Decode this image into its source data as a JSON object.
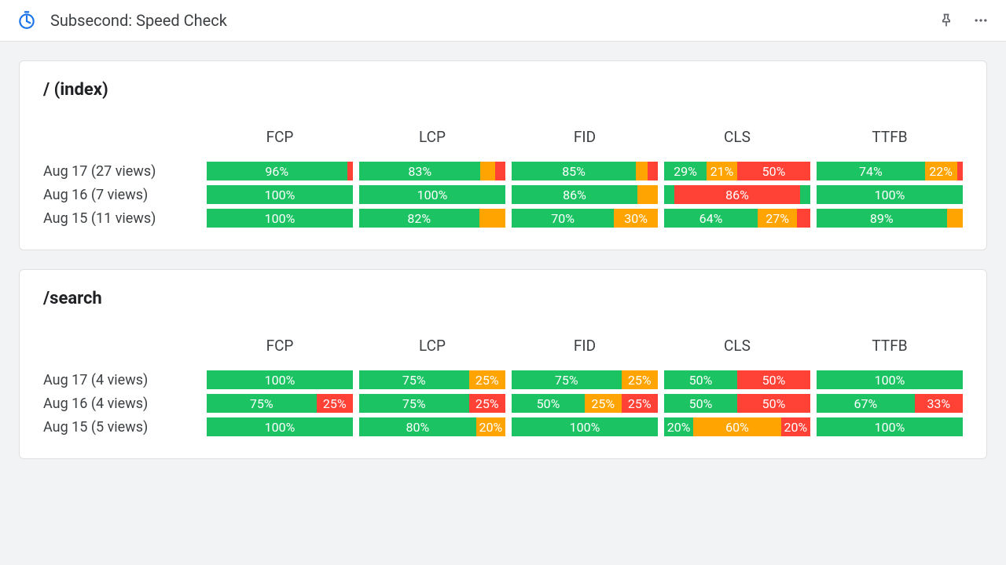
{
  "header": {
    "title": "Subsecond: Speed Check"
  },
  "columns": [
    "FCP",
    "LCP",
    "FID",
    "CLS",
    "TTFB"
  ],
  "colors": {
    "good": "#1cc363",
    "ok": "#ffa400",
    "bad": "#ff4136"
  },
  "cards": [
    {
      "title": "/ (index)",
      "rows": [
        {
          "label": "Aug 17 (27 views)",
          "metrics": [
            [
              {
                "c": "green",
                "p": 96,
                "t": "96%"
              },
              {
                "c": "red",
                "p": 4,
                "t": ""
              }
            ],
            [
              {
                "c": "green",
                "p": 83,
                "t": "83%"
              },
              {
                "c": "orange",
                "p": 10,
                "t": ""
              },
              {
                "c": "red",
                "p": 7,
                "t": ""
              }
            ],
            [
              {
                "c": "green",
                "p": 85,
                "t": "85%"
              },
              {
                "c": "orange",
                "p": 8,
                "t": ""
              },
              {
                "c": "red",
                "p": 7,
                "t": ""
              }
            ],
            [
              {
                "c": "green",
                "p": 29,
                "t": "29%"
              },
              {
                "c": "orange",
                "p": 21,
                "t": "21%"
              },
              {
                "c": "red",
                "p": 50,
                "t": "50%"
              }
            ],
            [
              {
                "c": "green",
                "p": 74,
                "t": "74%"
              },
              {
                "c": "orange",
                "p": 22,
                "t": "22%"
              },
              {
                "c": "red",
                "p": 4,
                "t": ""
              }
            ]
          ]
        },
        {
          "label": "Aug 16 (7 views)",
          "metrics": [
            [
              {
                "c": "green",
                "p": 100,
                "t": "100%"
              }
            ],
            [
              {
                "c": "green",
                "p": 100,
                "t": "100%"
              }
            ],
            [
              {
                "c": "green",
                "p": 86,
                "t": "86%"
              },
              {
                "c": "orange",
                "p": 14,
                "t": ""
              }
            ],
            [
              {
                "c": "green",
                "p": 7,
                "t": ""
              },
              {
                "c": "red",
                "p": 86,
                "t": "86%"
              },
              {
                "c": "green",
                "p": 7,
                "t": ""
              }
            ],
            [
              {
                "c": "green",
                "p": 100,
                "t": "100%"
              }
            ]
          ]
        },
        {
          "label": "Aug 15 (11 views)",
          "metrics": [
            [
              {
                "c": "green",
                "p": 100,
                "t": "100%"
              }
            ],
            [
              {
                "c": "green",
                "p": 82,
                "t": "82%"
              },
              {
                "c": "orange",
                "p": 18,
                "t": ""
              }
            ],
            [
              {
                "c": "green",
                "p": 70,
                "t": "70%"
              },
              {
                "c": "orange",
                "p": 30,
                "t": "30%"
              }
            ],
            [
              {
                "c": "green",
                "p": 64,
                "t": "64%"
              },
              {
                "c": "orange",
                "p": 27,
                "t": "27%"
              },
              {
                "c": "red",
                "p": 9,
                "t": ""
              }
            ],
            [
              {
                "c": "green",
                "p": 89,
                "t": "89%"
              },
              {
                "c": "orange",
                "p": 11,
                "t": ""
              }
            ]
          ]
        }
      ]
    },
    {
      "title": "/search",
      "rows": [
        {
          "label": "Aug 17 (4 views)",
          "metrics": [
            [
              {
                "c": "green",
                "p": 100,
                "t": "100%"
              }
            ],
            [
              {
                "c": "green",
                "p": 75,
                "t": "75%"
              },
              {
                "c": "orange",
                "p": 25,
                "t": "25%"
              }
            ],
            [
              {
                "c": "green",
                "p": 75,
                "t": "75%"
              },
              {
                "c": "orange",
                "p": 25,
                "t": "25%"
              }
            ],
            [
              {
                "c": "green",
                "p": 50,
                "t": "50%"
              },
              {
                "c": "red",
                "p": 50,
                "t": "50%"
              }
            ],
            [
              {
                "c": "green",
                "p": 100,
                "t": "100%"
              }
            ]
          ]
        },
        {
          "label": "Aug 16 (4 views)",
          "metrics": [
            [
              {
                "c": "green",
                "p": 75,
                "t": "75%"
              },
              {
                "c": "red",
                "p": 25,
                "t": "25%"
              }
            ],
            [
              {
                "c": "green",
                "p": 75,
                "t": "75%"
              },
              {
                "c": "red",
                "p": 25,
                "t": "25%"
              }
            ],
            [
              {
                "c": "green",
                "p": 50,
                "t": "50%"
              },
              {
                "c": "orange",
                "p": 25,
                "t": "25%"
              },
              {
                "c": "red",
                "p": 25,
                "t": "25%"
              }
            ],
            [
              {
                "c": "green",
                "p": 50,
                "t": "50%"
              },
              {
                "c": "red",
                "p": 50,
                "t": "50%"
              }
            ],
            [
              {
                "c": "green",
                "p": 67,
                "t": "67%"
              },
              {
                "c": "red",
                "p": 33,
                "t": "33%"
              }
            ]
          ]
        },
        {
          "label": "Aug 15 (5 views)",
          "metrics": [
            [
              {
                "c": "green",
                "p": 100,
                "t": "100%"
              }
            ],
            [
              {
                "c": "green",
                "p": 80,
                "t": "80%"
              },
              {
                "c": "orange",
                "p": 20,
                "t": "20%"
              }
            ],
            [
              {
                "c": "green",
                "p": 100,
                "t": "100%"
              }
            ],
            [
              {
                "c": "green",
                "p": 20,
                "t": "20%"
              },
              {
                "c": "orange",
                "p": 60,
                "t": "60%"
              },
              {
                "c": "red",
                "p": 20,
                "t": "20%"
              }
            ],
            [
              {
                "c": "green",
                "p": 100,
                "t": "100%"
              }
            ]
          ]
        }
      ]
    }
  ]
}
